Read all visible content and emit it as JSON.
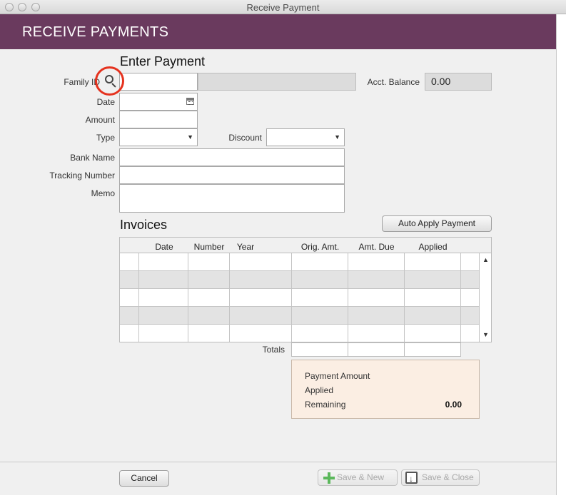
{
  "window": {
    "title": "Receive Payment"
  },
  "header": {
    "title": "RECEIVE PAYMENTS"
  },
  "enter_payment": {
    "section_title": "Enter Payment",
    "family_id_label": "Family ID",
    "family_id_value": "",
    "family_name_value": "",
    "acct_balance_label": "Acct. Balance",
    "acct_balance_value": "0.00",
    "date_label": "Date",
    "date_value": "",
    "amount_label": "Amount",
    "amount_value": "",
    "type_label": "Type",
    "type_value": "",
    "discount_label": "Discount",
    "discount_value": "",
    "bank_name_label": "Bank Name",
    "bank_name_value": "",
    "tracking_number_label": "Tracking Number",
    "tracking_number_value": "",
    "memo_label": "Memo",
    "memo_value": ""
  },
  "invoices": {
    "section_title": "Invoices",
    "auto_apply_label": "Auto Apply Payment",
    "columns": [
      "Date",
      "Number",
      "Year",
      "Orig. Amt.",
      "Amt. Due",
      "Applied"
    ],
    "rows": [
      [],
      [],
      [],
      [],
      []
    ],
    "totals_label": "Totals"
  },
  "summary": {
    "payment_amount_label": "Payment Amount",
    "applied_label": "Applied",
    "remaining_label": "Remaining",
    "remaining_value": "0.00"
  },
  "footer": {
    "cancel_label": "Cancel",
    "save_new_label": "Save & New",
    "save_close_label": "Save & Close"
  },
  "colors": {
    "header_bg": "#6a3a5e",
    "summary_bg": "#fbeee3",
    "search_highlight": "#e5321e",
    "plus_green": "#5cb85c"
  },
  "icons": [
    "close-window-icon",
    "minimize-window-icon",
    "zoom-window-icon",
    "search-icon",
    "calendar-icon",
    "dropdown-arrow-icon",
    "scroll-up-icon",
    "scroll-down-icon",
    "plus-icon",
    "save-close-icon"
  ]
}
